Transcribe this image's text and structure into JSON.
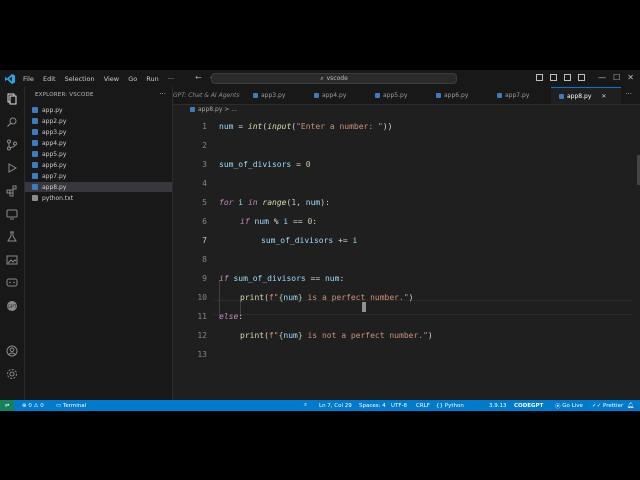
{
  "titlebar": {
    "menus": [
      "File",
      "Edit",
      "Selection",
      "View",
      "Go",
      "Run"
    ],
    "search_text": "vscode"
  },
  "sidebar": {
    "title": "EXPLORER: VSCODE",
    "files": [
      {
        "name": "app.py",
        "type": "py",
        "selected": false
      },
      {
        "name": "app2.py",
        "type": "py",
        "selected": false
      },
      {
        "name": "app3.py",
        "type": "py",
        "selected": false
      },
      {
        "name": "app4.py",
        "type": "py",
        "selected": false
      },
      {
        "name": "app5.py",
        "type": "py",
        "selected": false
      },
      {
        "name": "app6.py",
        "type": "py",
        "selected": false
      },
      {
        "name": "app7.py",
        "type": "py",
        "selected": false
      },
      {
        "name": "app8.py",
        "type": "py",
        "selected": true
      },
      {
        "name": "python.txt",
        "type": "txt",
        "selected": false
      }
    ]
  },
  "tabs": [
    {
      "label": "GPT: Chat & AI Agents",
      "active": false
    },
    {
      "label": "app3.py",
      "active": false
    },
    {
      "label": "app4.py",
      "active": false
    },
    {
      "label": "app5.py",
      "active": false
    },
    {
      "label": "app6.py",
      "active": false
    },
    {
      "label": "app7.py",
      "active": false
    },
    {
      "label": "app8.py",
      "active": true
    }
  ],
  "breadcrumb": "app8.py > ...",
  "editor": {
    "current_line": 7,
    "lines": [
      "1",
      "2",
      "3",
      "4",
      "5",
      "6",
      "7",
      "8",
      "9",
      "10",
      "11",
      "12",
      "13"
    ],
    "code": {
      "l1": [
        "num",
        " = ",
        "int",
        "(",
        "input",
        "(",
        "\"Enter a number: \"",
        "))"
      ],
      "l3": [
        "sum_of_divisors",
        " = ",
        "0"
      ],
      "l5": [
        "for",
        " ",
        "i",
        " ",
        "in",
        " ",
        "range",
        "(",
        "1",
        ", ",
        "num",
        "):"
      ],
      "l6": [
        "if",
        " ",
        "num",
        " % ",
        "i",
        " == ",
        "0",
        ":"
      ],
      "l7": [
        "sum_of_divisors",
        " += ",
        "i"
      ],
      "l9": [
        "if",
        " ",
        "sum_of_divisors",
        " == ",
        "num",
        ":"
      ],
      "l10": [
        "print",
        "(",
        "f\"",
        "{",
        "num",
        "}",
        " is a perfect number.\"",
        ")"
      ],
      "l11": [
        "else",
        ":"
      ],
      "l12": [
        "print",
        "(",
        "f\"",
        "{",
        "num",
        "}",
        " is not a perfect number.\"",
        ")"
      ]
    }
  },
  "statusbar": {
    "errors": "0",
    "warnings": "0",
    "terminal": "Terminal",
    "position": "Ln 7, Col 29",
    "spaces": "Spaces: 4",
    "encoding": "UTF-8",
    "eol": "CRLF",
    "language": "Python",
    "python_version": "3.9.13",
    "codegpt": "CODEGPT",
    "golive": "Go Live",
    "prettier": "Prettier"
  },
  "colors": {
    "accent": "#007acc",
    "editor_bg": "#1f1f1f",
    "sidebar_bg": "#181818",
    "keyword": "#c586c0",
    "variable": "#9cdcfe",
    "function": "#dcdcaa",
    "string": "#ce9178",
    "number": "#b5cea8"
  }
}
